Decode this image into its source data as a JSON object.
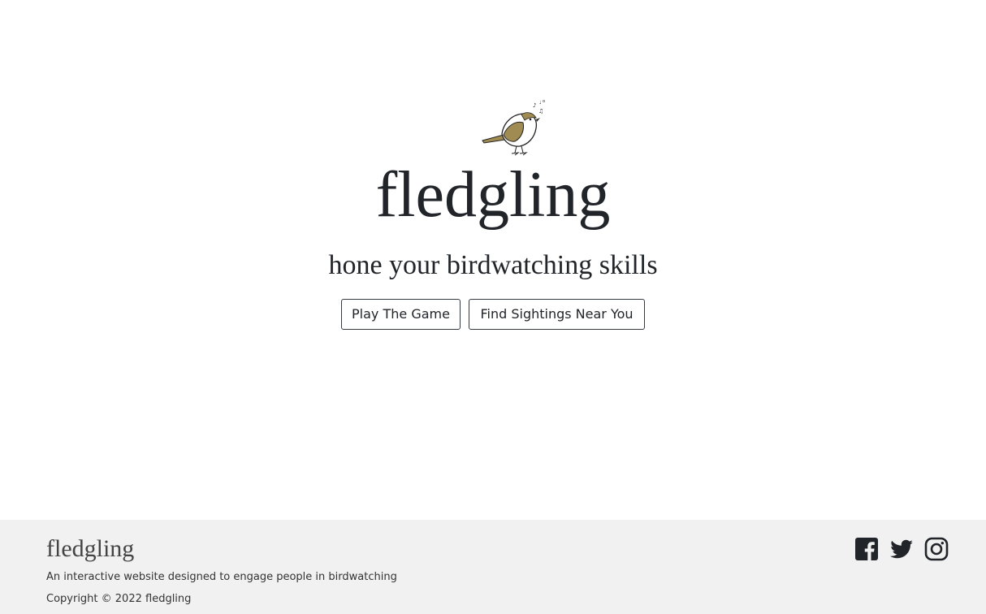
{
  "hero": {
    "logo_icon": "singing-bird-icon",
    "title": "fledgling",
    "tagline": "hone your birdwatching skills",
    "buttons": {
      "play_label": "Play The Game",
      "find_label": "Find Sightings Near You"
    }
  },
  "footer": {
    "brand": "fledgling",
    "description": "An interactive website designed to engage people in birdwatching",
    "copyright": "Copyright © 2022 fledgling",
    "social": [
      {
        "icon": "facebook-icon"
      },
      {
        "icon": "twitter-icon"
      },
      {
        "icon": "instagram-icon"
      }
    ]
  },
  "colors": {
    "text": "#212529",
    "footer_bg": "#f1f1f1",
    "bird_body": "#a08c52"
  }
}
